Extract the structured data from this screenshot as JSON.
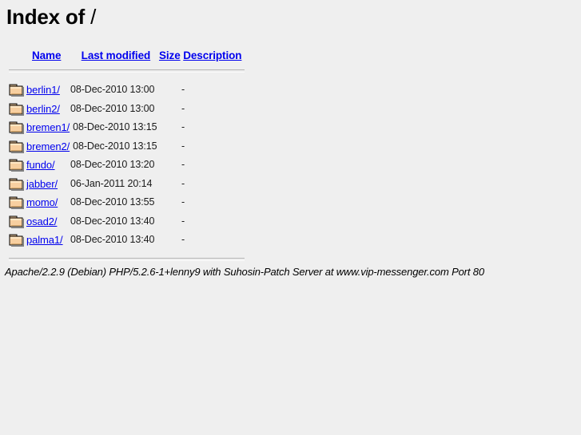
{
  "page": {
    "title_prefix": "Index of ",
    "path": "/",
    "background_color": "#efefef",
    "link_color": "#0000ee",
    "rule_color": "#b4b4b4"
  },
  "columns": {
    "name": "Name",
    "last_modified": "Last modified",
    "size": "Size",
    "description": "Description"
  },
  "entries": [
    {
      "icon": "folder-icon",
      "name": "berlin1/",
      "last_modified": "08-Dec-2010 13:00",
      "size": "-",
      "description": ""
    },
    {
      "icon": "folder-icon",
      "name": "berlin2/",
      "last_modified": "08-Dec-2010 13:00",
      "size": "-",
      "description": ""
    },
    {
      "icon": "folder-icon",
      "name": "bremen1/",
      "last_modified": "08-Dec-2010 13:15",
      "size": "-",
      "description": ""
    },
    {
      "icon": "folder-icon",
      "name": "bremen2/",
      "last_modified": "08-Dec-2010 13:15",
      "size": "-",
      "description": ""
    },
    {
      "icon": "folder-icon",
      "name": "fundo/",
      "last_modified": "08-Dec-2010 13:20",
      "size": "-",
      "description": ""
    },
    {
      "icon": "folder-icon",
      "name": "jabber/",
      "last_modified": "06-Jan-2011 20:14",
      "size": "-",
      "description": ""
    },
    {
      "icon": "folder-icon",
      "name": "momo/",
      "last_modified": "08-Dec-2010 13:55",
      "size": "-",
      "description": ""
    },
    {
      "icon": "folder-icon",
      "name": "osad2/",
      "last_modified": "08-Dec-2010 13:40",
      "size": "-",
      "description": ""
    },
    {
      "icon": "folder-icon",
      "name": "palma1/",
      "last_modified": "08-Dec-2010 13:40",
      "size": "-",
      "description": ""
    }
  ],
  "footer": {
    "server_signature": "Apache/2.2.9 (Debian) PHP/5.2.6-1+lenny9 with Suhosin-Patch Server at www.vip-messenger.com Port 80"
  }
}
